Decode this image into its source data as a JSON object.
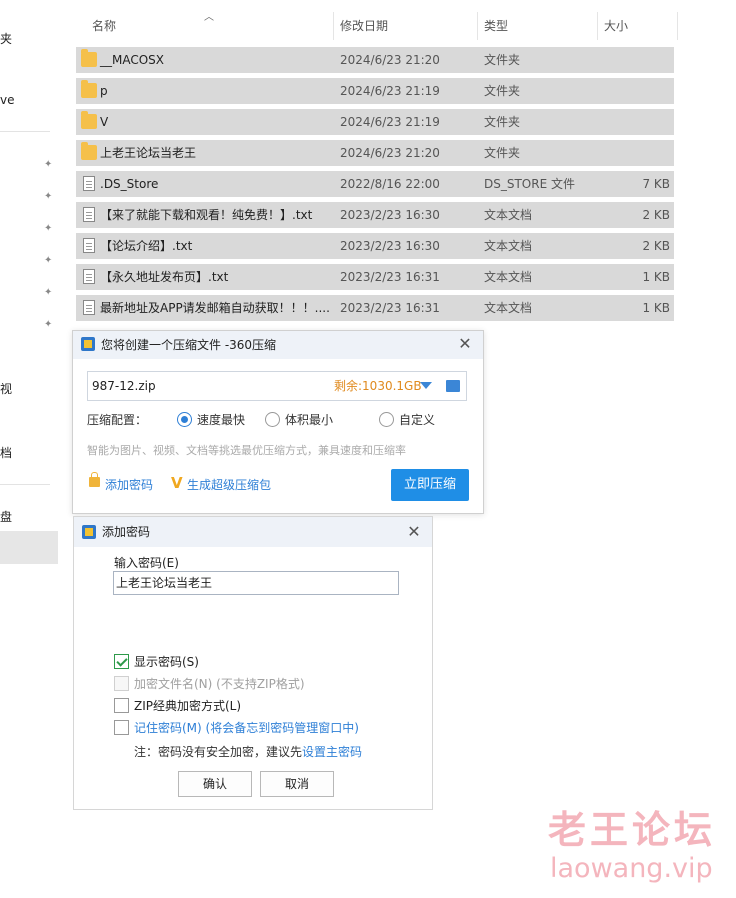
{
  "nav": {
    "fragments": [
      "夹",
      "ve",
      "视",
      "档",
      "盘"
    ]
  },
  "columns": {
    "name": "名称",
    "modified": "修改日期",
    "type": "类型",
    "size": "大小"
  },
  "files": [
    {
      "name": "__MACOSX",
      "modified": "2024/6/23 21:20",
      "type": "文件夹",
      "size": "",
      "kind": "folder"
    },
    {
      "name": "p",
      "modified": "2024/6/23 21:19",
      "type": "文件夹",
      "size": "",
      "kind": "folder"
    },
    {
      "name": "V",
      "modified": "2024/6/23 21:19",
      "type": "文件夹",
      "size": "",
      "kind": "folder"
    },
    {
      "name": "上老王论坛当老王",
      "modified": "2024/6/23 21:20",
      "type": "文件夹",
      "size": "",
      "kind": "folder"
    },
    {
      "name": ".DS_Store",
      "modified": "2022/8/16 22:00",
      "type": "DS_STORE 文件",
      "size": "7 KB",
      "kind": "file"
    },
    {
      "name": "【来了就能下载和观看！纯免费！】.txt",
      "modified": "2023/2/23 16:30",
      "type": "文本文档",
      "size": "2 KB",
      "kind": "file"
    },
    {
      "name": "【论坛介绍】.txt",
      "modified": "2023/2/23 16:30",
      "type": "文本文档",
      "size": "2 KB",
      "kind": "file"
    },
    {
      "name": "【永久地址发布页】.txt",
      "modified": "2023/2/23 16:31",
      "type": "文本文档",
      "size": "1 KB",
      "kind": "file"
    },
    {
      "name": "最新地址及APP请发邮箱自动获取！！！....",
      "modified": "2023/2/23 16:31",
      "type": "文本文档",
      "size": "1 KB",
      "kind": "file"
    }
  ],
  "compress_dialog": {
    "title": "您将创建一个压缩文件 -360压缩",
    "path": "987-12.zip",
    "free_space": "剩余:1030.1GB",
    "config_label": "压缩配置：",
    "options": [
      "速度最快",
      "体积最小",
      "自定义"
    ],
    "selected_option": "速度最快",
    "hint": "智能为图片、视频、文档等挑选最优压缩方式，兼具速度和压缩率",
    "add_password": "添加密码",
    "super_pack": "生成超级压缩包",
    "compress_button": "立即压缩"
  },
  "password_dialog": {
    "title": "添加密码",
    "input_label": "输入密码(E)",
    "password_value": "上老王论坛当老王",
    "show_password": {
      "label": "显示密码(S)",
      "checked": true
    },
    "encrypt_filenames": {
      "label": "加密文件名(N) (不支持ZIP格式)",
      "checked": false,
      "disabled": true
    },
    "zip_classic": {
      "label": "ZIP经典加密方式(L)",
      "checked": false
    },
    "remember_password": {
      "label": "记住密码(M) (将会备忘到密码管理窗口中)",
      "checked": false
    },
    "note_prefix": "注：密码没有安全加密，建议先",
    "note_link": "设置主密码",
    "ok_button": "确认",
    "cancel_button": "取消"
  },
  "watermark": {
    "cn": "老王论坛",
    "en": "laowang.vip"
  },
  "colors": {
    "row_highlight": "#d9d9d9",
    "accent_blue": "#1f8ee6",
    "link_blue": "#2e7fd6",
    "free_space_orange": "#e08a1e",
    "folder_yellow": "#f5c04a",
    "watermark_pink": "#f4b5bd"
  }
}
